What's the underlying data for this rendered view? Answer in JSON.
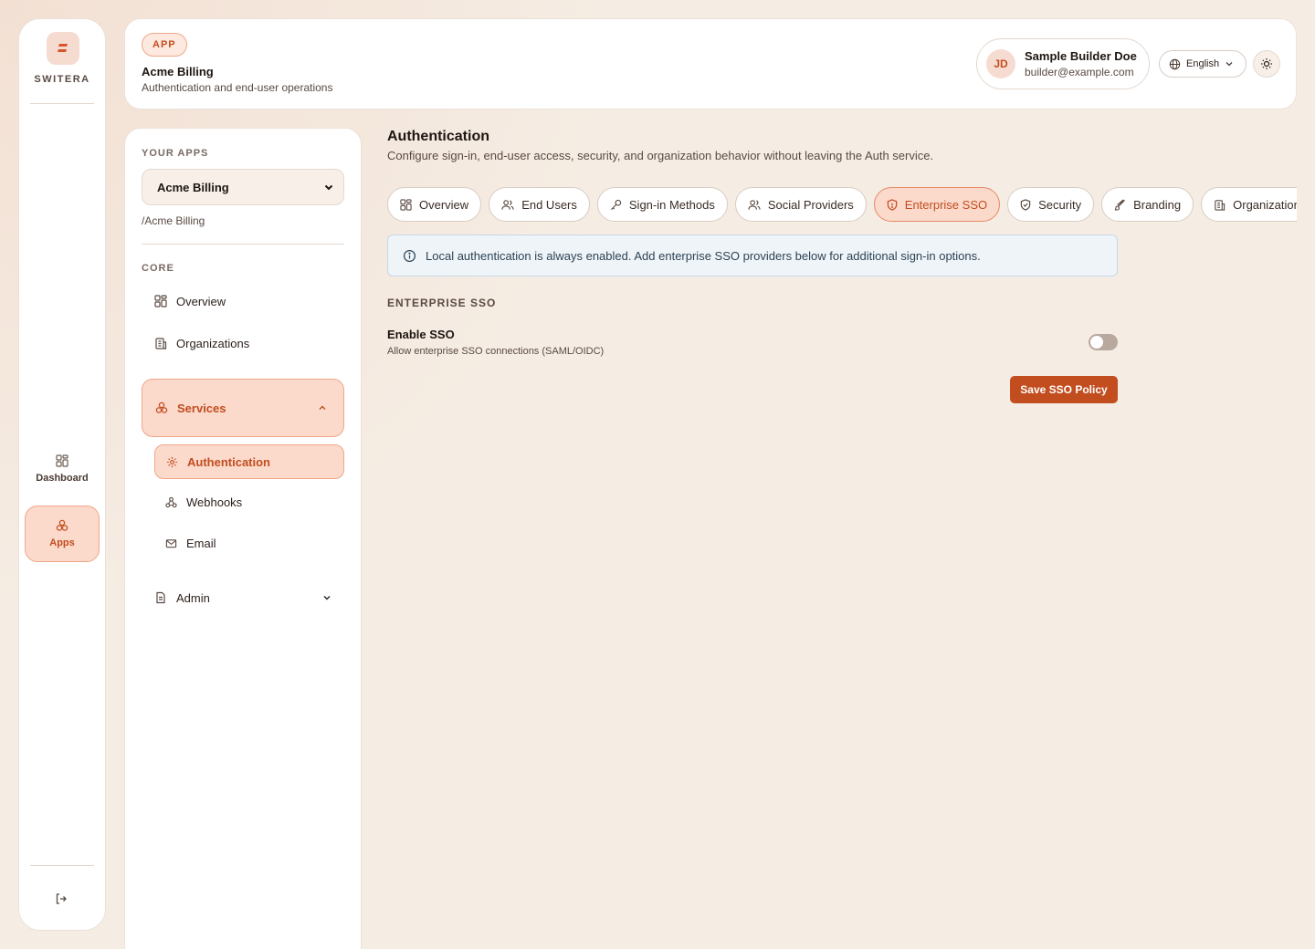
{
  "rail": {
    "brand": "SWITERA",
    "items": [
      {
        "label": "Dashboard"
      },
      {
        "label": "Apps"
      }
    ]
  },
  "header": {
    "badge": "APP",
    "app_title": "Acme Billing",
    "app_subtitle": "Authentication and end-user operations",
    "user": {
      "initials": "JD",
      "name": "Sample Builder Doe",
      "email": "builder@example.com"
    },
    "language": "English"
  },
  "sidebar": {
    "your_apps_label": "YOUR APPS",
    "selected_app": "Acme Billing",
    "app_slug": "/Acme Billing",
    "core_label": "CORE",
    "core_items": [
      {
        "label": "Overview"
      },
      {
        "label": "Organizations"
      }
    ],
    "services_label": "Services",
    "service_items": [
      {
        "label": "Authentication"
      },
      {
        "label": "Webhooks"
      },
      {
        "label": "Email"
      }
    ],
    "admin_label": "Admin"
  },
  "main": {
    "title": "Authentication",
    "subtitle": "Configure sign-in, end-user access, security, and organization behavior without leaving the Auth service.",
    "tabs": [
      {
        "label": "Overview"
      },
      {
        "label": "End Users"
      },
      {
        "label": "Sign-in Methods"
      },
      {
        "label": "Social Providers"
      },
      {
        "label": "Enterprise SSO"
      },
      {
        "label": "Security"
      },
      {
        "label": "Branding"
      },
      {
        "label": "Organizations"
      }
    ],
    "info_text": "Local authentication is always enabled. Add enterprise SSO providers below for additional sign-in options.",
    "section_title": "ENTERPRISE SSO",
    "enable_sso_label": "Enable SSO",
    "enable_sso_desc": "Allow enterprise SSO connections (SAML/OIDC)",
    "enable_sso_on": false,
    "save_label": "Save SSO Policy"
  },
  "colors": {
    "accent": "#c24d1f",
    "accent_soft": "#fbd9cb",
    "background": "#f5ede4"
  }
}
